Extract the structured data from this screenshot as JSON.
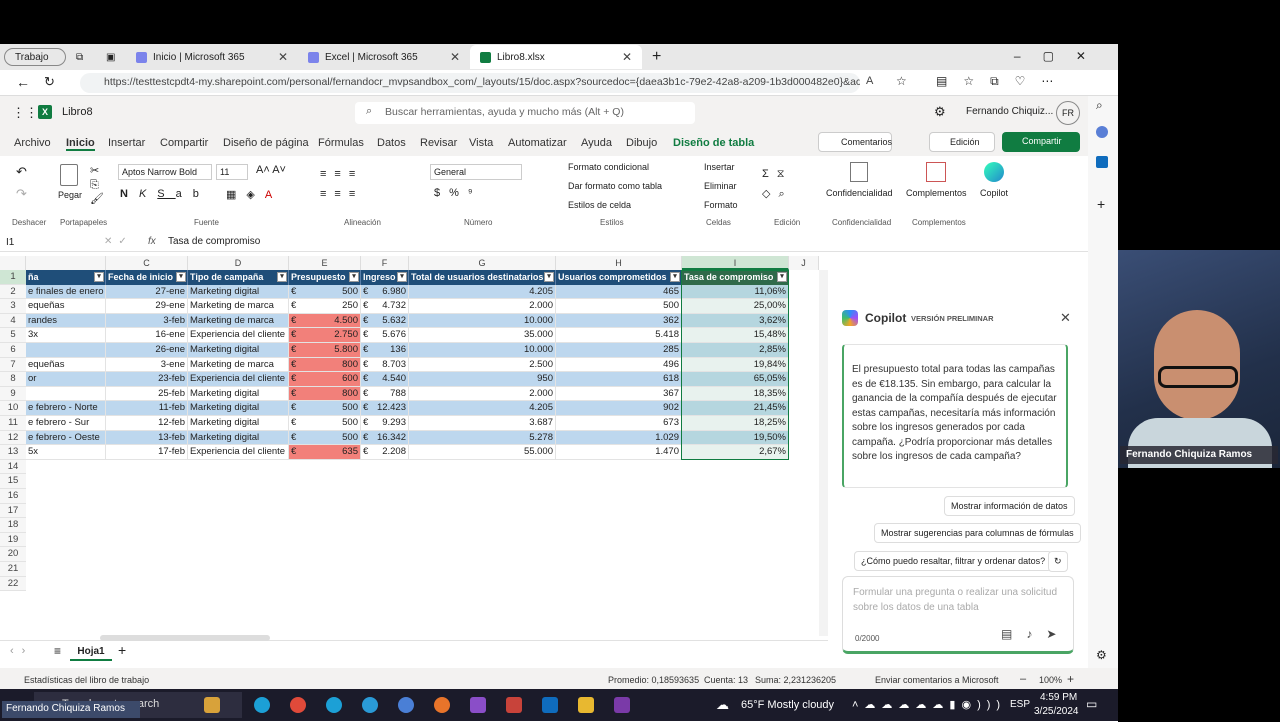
{
  "browser": {
    "profile": "Trabajo",
    "tabs": [
      {
        "label": "Inicio | Microsoft 365"
      },
      {
        "label": "Excel | Microsoft 365"
      },
      {
        "label": "Libro8.xlsx"
      }
    ],
    "url": "https://testtestcpdt4-my.sharepoint.com/personal/fernandocr_mvpsandbox_com/_layouts/15/doc.aspx?sourcedoc={daea3b1c-79e2-42a8-a209-1b3d000482e0}&acti..."
  },
  "office": {
    "filename": "Libro8",
    "search_placeholder": "Buscar herramientas, ayuda y mucho más (Alt + Q)",
    "user": "Fernando Chiquiz...",
    "initials": "FR"
  },
  "menu": [
    "Archivo",
    "Inicio",
    "Insertar",
    "Compartir",
    "Diseño de página",
    "Fórmulas",
    "Datos",
    "Revisar",
    "Vista",
    "Automatizar",
    "Ayuda",
    "Dibujo",
    "Diseño de tabla"
  ],
  "menu_right": {
    "comments": "Comentarios",
    "edit": "Edición",
    "share": "Compartir"
  },
  "ribbon": {
    "groups": [
      "Deshacer",
      "Portapapeles",
      "Fuente",
      "Alineación",
      "Número",
      "Estilos",
      "Celdas",
      "Edición",
      "Confidencialidad",
      "Complementos"
    ],
    "paste": "Pegar",
    "font": "Aptos Narrow Bold",
    "size": "11",
    "numformat": "General",
    "styles": [
      "Formato condicional",
      "Dar formato como tabla",
      "Estilos de celda"
    ],
    "cells": [
      "Insertar",
      "Eliminar",
      "Formato"
    ],
    "big": [
      "Confidencialidad",
      "Complementos",
      "Copilot"
    ]
  },
  "formula": {
    "namebox": "I1",
    "fx": "fx",
    "content": "Tasa de compromiso"
  },
  "columns": [
    "C",
    "D",
    "E",
    "F",
    "G",
    "H",
    "I",
    "J"
  ],
  "headers": [
    "ña",
    "Fecha de inicio",
    "Tipo de campaña",
    "Presupuesto",
    "Ingreso",
    "Total de usuarios destinatarios",
    "Usuarios comprometidos",
    "Tasa de compromiso"
  ],
  "rows": [
    [
      "e finales de enero",
      "27-ene",
      "Marketing digital",
      "€",
      "500",
      "€",
      "6.980",
      "4.205",
      "465",
      "11,06%"
    ],
    [
      "equeñas",
      "29-ene",
      "Marketing de marca",
      "€",
      "250",
      "€",
      "4.732",
      "2.000",
      "500",
      "25,00%"
    ],
    [
      "randes",
      "3-feb",
      "Marketing de marca",
      "€",
      "4.500",
      "€",
      "5.632",
      "10.000",
      "362",
      "3,62%"
    ],
    [
      "3x",
      "16-ene",
      "Experiencia del cliente",
      "€",
      "2.750",
      "€",
      "5.676",
      "35.000",
      "5.418",
      "15,48%"
    ],
    [
      "",
      "26-ene",
      "Marketing digital",
      "€",
      "5.800",
      "€",
      "136",
      "10.000",
      "285",
      "2,85%"
    ],
    [
      "equeñas",
      "3-ene",
      "Marketing de marca",
      "€",
      "800",
      "€",
      "8.703",
      "2.500",
      "496",
      "19,84%"
    ],
    [
      "or",
      "23-feb",
      "Experiencia del cliente",
      "€",
      "600",
      "€",
      "4.540",
      "950",
      "618",
      "65,05%"
    ],
    [
      "",
      "25-feb",
      "Marketing digital",
      "€",
      "800",
      "€",
      "788",
      "2.000",
      "367",
      "18,35%"
    ],
    [
      "e febrero - Norte",
      "11-feb",
      "Marketing digital",
      "€",
      "500",
      "€",
      "12.423",
      "4.205",
      "902",
      "21,45%"
    ],
    [
      "e febrero - Sur",
      "12-feb",
      "Marketing digital",
      "€",
      "500",
      "€",
      "9.293",
      "3.687",
      "673",
      "18,25%"
    ],
    [
      "e febrero - Oeste",
      "13-feb",
      "Marketing digital",
      "€",
      "500",
      "€",
      "16.342",
      "5.278",
      "1.029",
      "19,50%"
    ],
    [
      "5x",
      "17-feb",
      "Experiencia del cliente",
      "€",
      "635",
      "€",
      "2.208",
      "55.000",
      "1.470",
      "2,67%"
    ]
  ],
  "red_rows": [
    2,
    3,
    4,
    5,
    6,
    7,
    11
  ],
  "rownums": [
    "1",
    "2",
    "3",
    "4",
    "5",
    "6",
    "7",
    "8",
    "9",
    "10",
    "11",
    "12",
    "13",
    "14",
    "15",
    "16",
    "17",
    "18",
    "19",
    "20",
    "21",
    "22"
  ],
  "sheet_tab": "Hoja1",
  "status": {
    "left": "Estadísticas del libro de trabajo",
    "avg": "Promedio: 0,18593635",
    "count": "Cuenta: 13",
    "sum": "Suma: 2,231236205",
    "feedback": "Enviar comentarios a Microsoft",
    "zoom": "100%"
  },
  "copilot": {
    "title": "Copilot",
    "badge": "VERSIÓN PRELIMINAR",
    "message": "El presupuesto total para todas las campañas es de €18.135. Sin embargo, para calcular la ganancia de la compañía después de ejecutar estas campañas, necesitaría más información sobre los ingresos generados por cada campaña. ¿Podría proporcionar más detalles sobre los ingresos de cada campaña?",
    "chips": [
      "Mostrar información de datos",
      "Mostrar sugerencias para columnas de fórmulas",
      "¿Cómo puedo resaltar, filtrar y ordenar datos?"
    ],
    "placeholder": "Formular una pregunta o realizar una solicitud sobre los datos de una tabla",
    "counter": "0/2000"
  },
  "taskbar": {
    "search": "Type here to search",
    "weather": "65°F  Mostly cloudy",
    "lang": "ESP",
    "time": "4:59 PM",
    "date": "3/25/2024"
  },
  "webcam": {
    "name": "Fernando Chiquiza Ramos"
  },
  "bottom_label": "Fernando Chiquiza Ramos"
}
